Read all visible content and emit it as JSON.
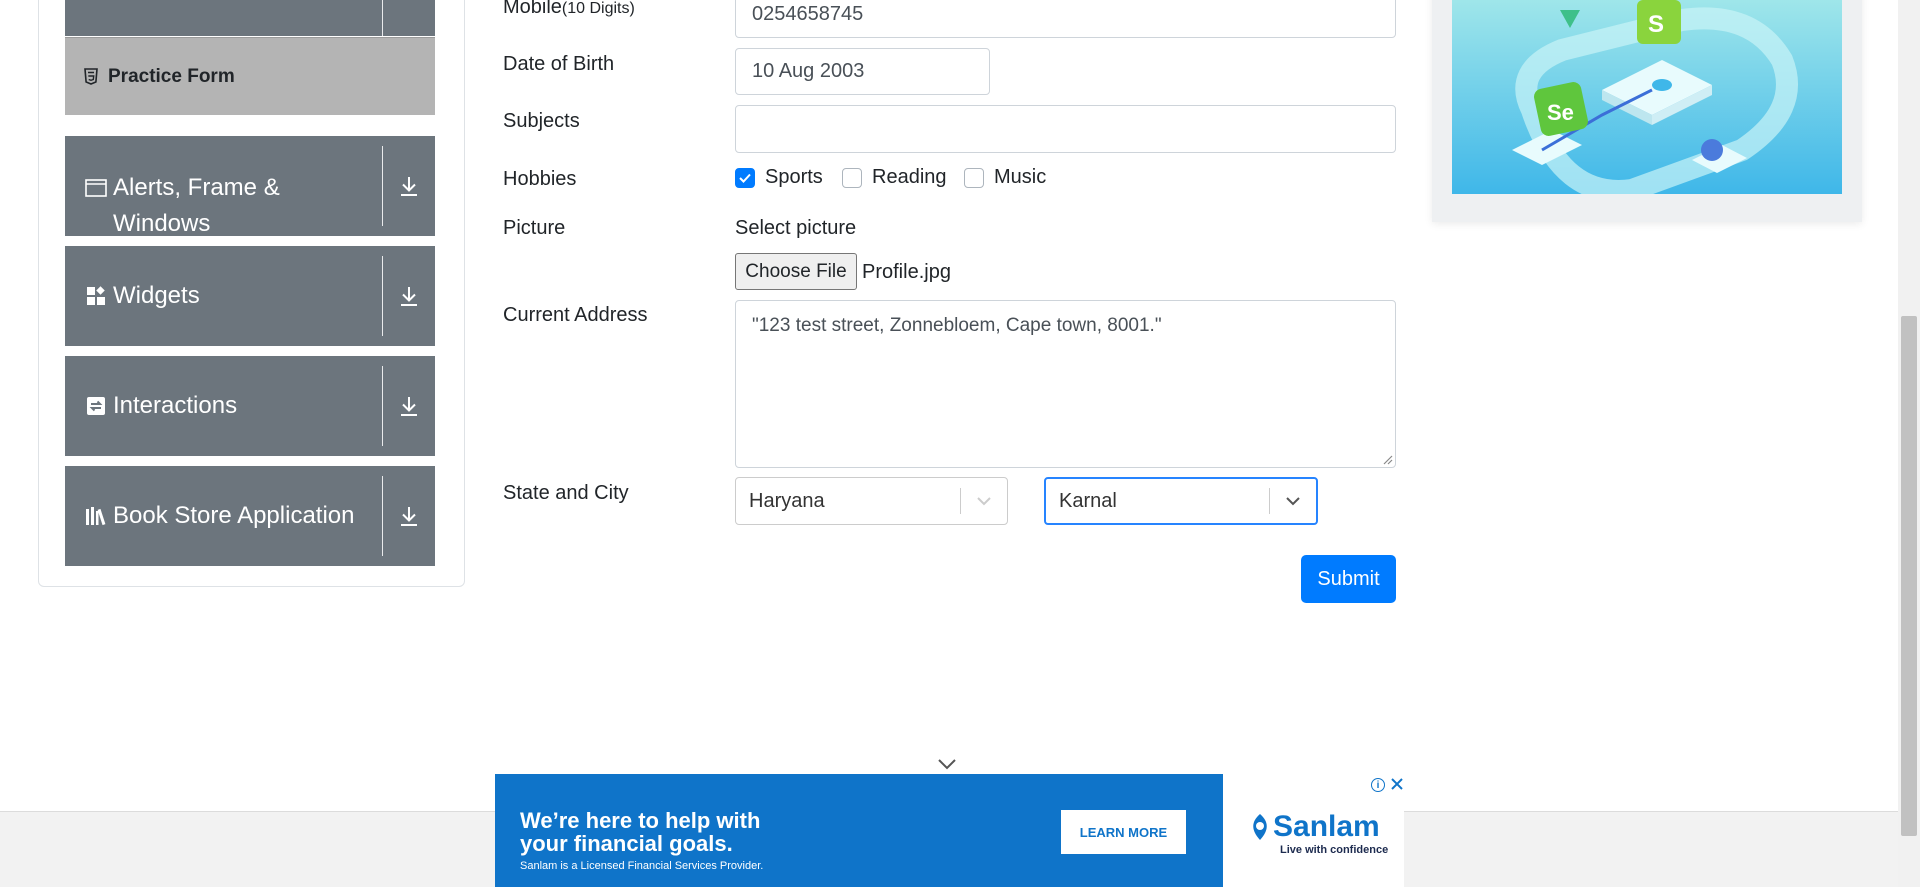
{
  "sidebar": {
    "active_item": {
      "label": "Practice Form",
      "icon": "html5-icon"
    },
    "groups": [
      {
        "label": "Alerts, Frame & Windows",
        "line1": "Alerts, Frame &",
        "line2": "Windows",
        "icon": "window-icon"
      },
      {
        "label": "Widgets",
        "icon": "widgets-icon"
      },
      {
        "label": "Interactions",
        "icon": "interactions-icon"
      },
      {
        "label": "Book Store Application",
        "icon": "books-icon"
      }
    ]
  },
  "form": {
    "mobile": {
      "label": "Mobile",
      "hint": "(10 Digits)",
      "value": "0254658745"
    },
    "dob": {
      "label": "Date of Birth",
      "value": "10 Aug 2003"
    },
    "subjects": {
      "label": "Subjects",
      "value": ""
    },
    "hobbies": {
      "label": "Hobbies",
      "options": [
        {
          "label": "Sports",
          "checked": true
        },
        {
          "label": "Reading",
          "checked": false
        },
        {
          "label": "Music",
          "checked": false
        }
      ]
    },
    "picture": {
      "label": "Picture",
      "prompt": "Select picture",
      "button": "Choose File",
      "file": "Profile.jpg"
    },
    "address": {
      "label": "Current Address",
      "value": "\"123 test street, Zonnebloem, Cape town, 8001.\""
    },
    "state_city": {
      "label": "State and City",
      "state": "Haryana",
      "city": "Karnal"
    },
    "submit": "Submit"
  },
  "ad": {
    "headline_1": "We’re here to help with",
    "headline_2": "your financial goals.",
    "disclaimer": "Sanlam is a Licensed Financial Services Provider.",
    "cta": "LEARN MORE",
    "brand": "Sanlam",
    "tagline": "Live with confidence"
  },
  "colors": {
    "accent": "#007bff",
    "sidebar_group": "#6c757d",
    "sidebar_active": "#b4b4b4",
    "ad_blue": "#0f74c9"
  }
}
